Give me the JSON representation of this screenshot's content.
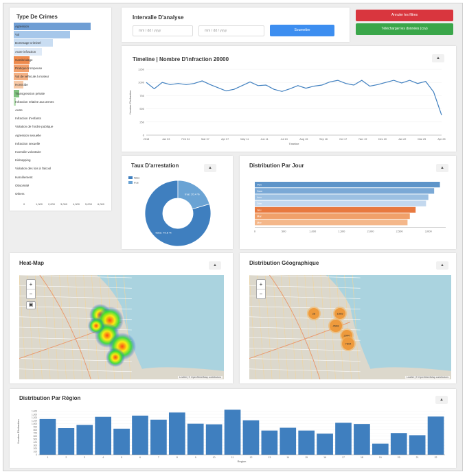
{
  "crime_types": {
    "title": "Type De Crimes",
    "items": [
      {
        "label": "Agression",
        "value": 0.98,
        "color": "#6f9ed4"
      },
      {
        "label": "Vol",
        "value": 0.72,
        "color": "#a6c7ea"
      },
      {
        "label": "Dommage criminel",
        "value": 0.5,
        "color": "#c9ddf2"
      },
      {
        "label": "Autre infraction",
        "value": 0.36,
        "color": "#dfeaf7"
      },
      {
        "label": "Cambriolage",
        "value": 0.2,
        "color": "#ee8a4c"
      },
      {
        "label": "Pratique trompeuse",
        "value": 0.19,
        "color": "#f2a06b"
      },
      {
        "label": "Vol de véhicule à moteur",
        "value": 0.18,
        "color": "#f4b184"
      },
      {
        "label": "Homicide",
        "value": 0.12,
        "color": "#f7c9a6"
      },
      {
        "label": "Transgression pénale",
        "value": 0.07,
        "color": "#7fc27f"
      },
      {
        "label": "Infraction relative aux armes",
        "value": 0.03,
        "color": "#b8e0b5"
      },
      {
        "label": "Autre",
        "value": 0.02,
        "color": "#ffffff"
      },
      {
        "label": "Infraction d'enfants",
        "value": 0.02,
        "color": "#ffffff"
      },
      {
        "label": "Violation de l'ordre publique",
        "value": 0.01,
        "color": "#ffffff"
      },
      {
        "label": "Agression sexuelle",
        "value": 0.01,
        "color": "#ffffff"
      },
      {
        "label": "Infraction sexuelle",
        "value": 0.01,
        "color": "#ffffff"
      },
      {
        "label": "Incendie volontaire",
        "value": 0.01,
        "color": "#ffffff"
      },
      {
        "label": "Kidnapping",
        "value": 0.01,
        "color": "#ffffff"
      },
      {
        "label": "Violation des lois à l'alcool",
        "value": 0.01,
        "color": "#ffffff"
      },
      {
        "label": "Harcèlement",
        "value": 0.01,
        "color": "#ffffff"
      },
      {
        "label": "Obscénité",
        "value": 0.01,
        "color": "#ffffff"
      },
      {
        "label": "Others",
        "value": 0.01,
        "color": "#ffffff"
      }
    ],
    "axis_ticks": [
      "0",
      "1,000",
      "2,000",
      "3,000",
      "4,000",
      "5,000",
      "6,000"
    ]
  },
  "analysis": {
    "title": "Intervalle D'analyse",
    "start_placeholder": "mm / dd / yyyy",
    "end_placeholder": "mm / dd / yyyy",
    "submit_label": "Soumettre"
  },
  "actions": {
    "cancel_filters_label": "Annuler les filtres",
    "download_label": "Télécharger les données (csv)",
    "cancel_color": "#d9363e",
    "download_color": "#3aa64a"
  },
  "timeline": {
    "title": "Timeline | Nombre D'infraction 20000",
    "menu_icon": "hamburger-icon",
    "chart_data": {
      "type": "line",
      "ylabel": "Nombre D'infraction",
      "xlabel": "Timeline",
      "yticks": [
        "0",
        "250",
        "500",
        "750",
        "1000",
        "1250"
      ],
      "ylim": [
        0,
        1250
      ],
      "xticks": [
        "2018",
        "Jan 03",
        "Feb 04",
        "Mar 07",
        "Apr 07",
        "May 11",
        "Jun 11",
        "Jul 13",
        "Aug 15",
        "Sep 16",
        "Oct 17",
        "Nov 19",
        "Dec 20",
        "Jan 22",
        "Mar 25",
        "Apr 25"
      ],
      "values": [
        1000,
        880,
        1000,
        960,
        980,
        960,
        980,
        1030,
        960,
        900,
        840,
        870,
        940,
        1010,
        940,
        950,
        870,
        830,
        880,
        940,
        890,
        930,
        950,
        1010,
        1040,
        980,
        950,
        1040,
        930,
        960,
        1000,
        1040,
        990,
        1040,
        980,
        1020,
        820,
        380
      ],
      "color": "#3f7fbf"
    }
  },
  "arrest": {
    "title": "Taux D'arrestation",
    "menu_icon": "hamburger-icon",
    "chart_data": {
      "type": "pie",
      "labels": [
        "false",
        "true"
      ],
      "values": [
        79.6,
        20.4
      ],
      "slice_labels": [
        "false: 79.6 %",
        "true: 20.4 %"
      ],
      "colors": [
        "#3f7fbf",
        "#6aa3d4"
      ]
    }
  },
  "day_distribution": {
    "title": "Distribution Par Jour",
    "menu_icon": "hamburger-icon",
    "chart_data": {
      "type": "bar",
      "categories": [
        "Ven",
        "Sam",
        "Lun",
        "Dim",
        "Jeu",
        "Mar",
        "Mer"
      ],
      "values": [
        3200,
        3100,
        3000,
        2960,
        2780,
        2680,
        2640
      ],
      "colors": [
        "#5d94c9",
        "#7ba9d6",
        "#9cc0e2",
        "#c3d8ee",
        "#e8793f",
        "#f0a06a",
        "#f4b78a"
      ],
      "xticks": [
        "0",
        "500",
        "1,000",
        "1,500",
        "2,000",
        "2,500",
        "3,000"
      ],
      "xlim": [
        0,
        3300
      ]
    }
  },
  "heatmap": {
    "title": "Heat-Map",
    "menu_icon": "hamburger-icon",
    "zoom_in": "+",
    "zoom_out": "−",
    "layers_icon": "layers-icon",
    "attribution": "Leaflet | © OpenStreetMap contributors"
  },
  "geo_distribution": {
    "title": "Distribution Géographique",
    "menu_icon": "hamburger-icon",
    "zoom_in": "+",
    "zoom_out": "−",
    "clusters": [
      {
        "label": "28"
      },
      {
        "label": "1865"
      },
      {
        "label": "4598"
      },
      {
        "label": "2986"
      },
      {
        "label": "7894"
      }
    ],
    "attribution": "Leaflet | © OpenStreetMap contributors"
  },
  "region_distribution": {
    "title": "Distribution Par Région",
    "menu_icon": "hamburger-icon",
    "chart_data": {
      "type": "bar",
      "ylabel": "Nombre D'infraction",
      "xlabel": "Region",
      "categories": [
        "1",
        "2",
        "3",
        "4",
        "5",
        "6",
        "7",
        "8",
        "9",
        "10",
        "11",
        "12",
        "13",
        "14",
        "15",
        "16",
        "17",
        "18",
        "19",
        "20",
        "21",
        "22"
      ],
      "values": [
        1150,
        860,
        960,
        1220,
        840,
        1260,
        1130,
        1360,
        1000,
        980,
        1450,
        1110,
        780,
        870,
        780,
        680,
        1030,
        990,
        360,
        700,
        630,
        1230
      ],
      "yticks": [
        "0",
        "100",
        "200",
        "300",
        "400",
        "500",
        "600",
        "700",
        "800",
        "900",
        "1,000",
        "1,100",
        "1,200",
        "1,300",
        "1,400"
      ],
      "ylim": [
        0,
        1500
      ],
      "color": "#3f7fbf"
    }
  }
}
